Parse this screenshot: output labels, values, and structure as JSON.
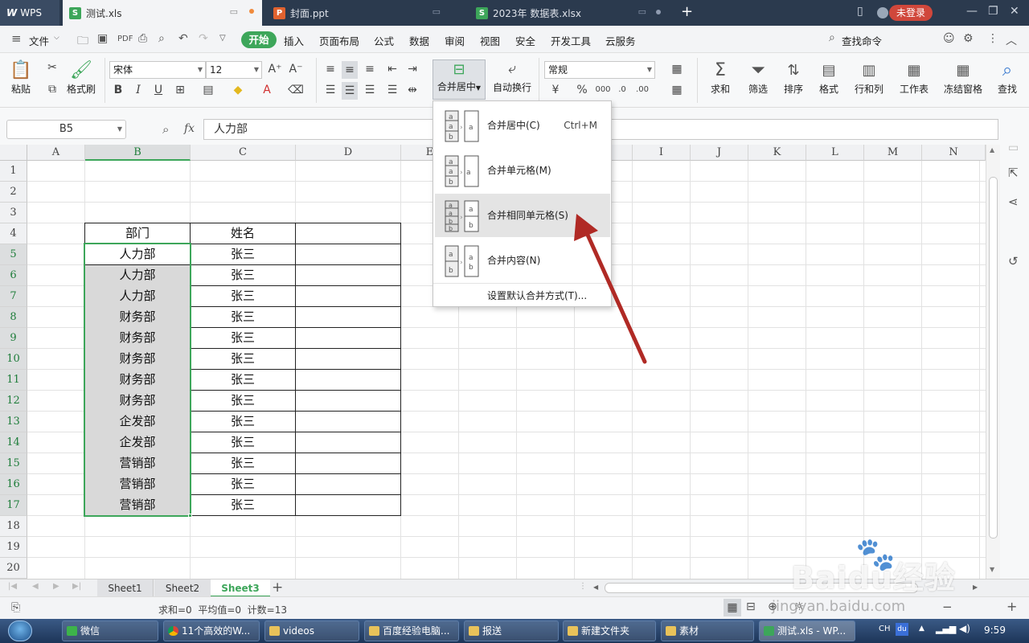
{
  "titlebar": {
    "app_name": "WPS",
    "tabs": [
      {
        "label": "测试.xls",
        "icon": "S",
        "icon_color": "#3da65a",
        "active": true
      },
      {
        "label": "封面.ppt",
        "icon": "P",
        "icon_color": "#e0622f",
        "active": false
      },
      {
        "label": "2023年 数据表.xlsx",
        "icon": "S",
        "icon_color": "#3da65a",
        "active": false
      }
    ],
    "login_label": "未登录"
  },
  "menubar": {
    "file_label": "文件",
    "items": [
      "开始",
      "插入",
      "页面布局",
      "公式",
      "数据",
      "审阅",
      "视图",
      "安全",
      "开发工具",
      "云服务"
    ],
    "search_label": "查找命令"
  },
  "ribbon": {
    "paste_label": "粘贴",
    "format_painter_label": "格式刷",
    "font_name": "宋体",
    "font_size": "12",
    "merge_center_label": "合并居中",
    "wrap_label": "自动换行",
    "number_format": "常规",
    "sum_label": "求和",
    "filter_label": "筛选",
    "sort_label": "排序",
    "format_label": "格式",
    "rowcol_label": "行和列",
    "sheet_label": "工作表",
    "freeze_label": "冻结窗格",
    "find_label": "查找"
  },
  "formula_bar": {
    "name_box": "B5",
    "fx": "fx",
    "content": "人力部"
  },
  "grid": {
    "columns": [
      "A",
      "B",
      "C",
      "D",
      "E",
      "F",
      "G",
      "H",
      "I",
      "J",
      "K",
      "L",
      "M",
      "N"
    ],
    "rows": [
      "1",
      "2",
      "3",
      "4",
      "5",
      "6",
      "7",
      "8",
      "9",
      "10",
      "11",
      "12",
      "13",
      "14",
      "15",
      "16",
      "17",
      "18",
      "19",
      "20"
    ],
    "header": [
      "部门",
      "姓名"
    ],
    "data": [
      [
        "人力部",
        "张三"
      ],
      [
        "人力部",
        "张三"
      ],
      [
        "人力部",
        "张三"
      ],
      [
        "财务部",
        "张三"
      ],
      [
        "财务部",
        "张三"
      ],
      [
        "财务部",
        "张三"
      ],
      [
        "财务部",
        "张三"
      ],
      [
        "财务部",
        "张三"
      ],
      [
        "企发部",
        "张三"
      ],
      [
        "企发部",
        "张三"
      ],
      [
        "营销部",
        "张三"
      ],
      [
        "营销部",
        "张三"
      ],
      [
        "营销部",
        "张三"
      ]
    ]
  },
  "dropdown": {
    "items": [
      {
        "label": "合并居中(C)",
        "shortcut": "Ctrl+M"
      },
      {
        "label": "合并单元格(M)",
        "shortcut": ""
      },
      {
        "label": "合并相同单元格(S)",
        "shortcut": ""
      },
      {
        "label": "合并内容(N)",
        "shortcut": ""
      }
    ],
    "footer": "设置默认合并方式(T)..."
  },
  "sheet_tabs": [
    "Sheet1",
    "Sheet2",
    "Sheet3"
  ],
  "active_sheet": "Sheet3",
  "status": {
    "text": "求和=0  平均值=0  计数=13"
  },
  "taskbar": {
    "items": [
      {
        "label": "微信",
        "color": "#3db34a"
      },
      {
        "label": "11个高效的W...",
        "color": "#e9b936"
      },
      {
        "label": "videos",
        "color": "#e8c25a"
      },
      {
        "label": "百度经验电脑...",
        "color": "#e8c25a"
      },
      {
        "label": "报送",
        "color": "#e8c25a"
      },
      {
        "label": "新建文件夹",
        "color": "#e8c25a"
      },
      {
        "label": "素材",
        "color": "#e8c25a"
      },
      {
        "label": "测试.xls - WP...",
        "color": "#3da65a"
      }
    ],
    "lang": "CH",
    "time": "9:59"
  },
  "watermark": {
    "brand": "Baidu经验",
    "url": "jingyan.baidu.com"
  },
  "colors": {
    "accent_green": "#3da65a",
    "arrow_red": "#b02a25",
    "titlebar": "#2b3a4e",
    "login_badge": "#d0473b"
  }
}
